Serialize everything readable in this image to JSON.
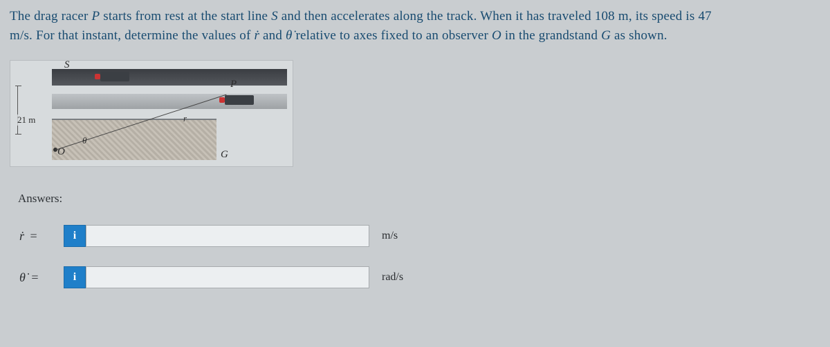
{
  "problem": {
    "line1_a": "The drag racer ",
    "line1_b": " starts from rest at the start line ",
    "line1_c": " and then accelerates along the track. When it has traveled 108 m, its speed is 47",
    "line2_a": "m/s. For that instant, determine the values of ",
    "line2_b": " and ",
    "line2_c": " relative to axes fixed to an observer ",
    "line2_d": " in the grandstand ",
    "line2_e": " as shown.",
    "P": "P",
    "S": "S",
    "rdot": "ṙ",
    "thetadot": "θ̇",
    "O": "O",
    "G": "G"
  },
  "figure": {
    "dim": "21 m",
    "S": "S",
    "P": "P",
    "r": "r",
    "G": "G",
    "O": "O",
    "theta": "θ"
  },
  "answers_label": "Answers:",
  "rows": [
    {
      "var": "ṙ",
      "eq": "=",
      "info": "i",
      "unit": "m/s"
    },
    {
      "var": "θ̇",
      "eq": "=",
      "info": "i",
      "unit": "rad/s"
    }
  ]
}
